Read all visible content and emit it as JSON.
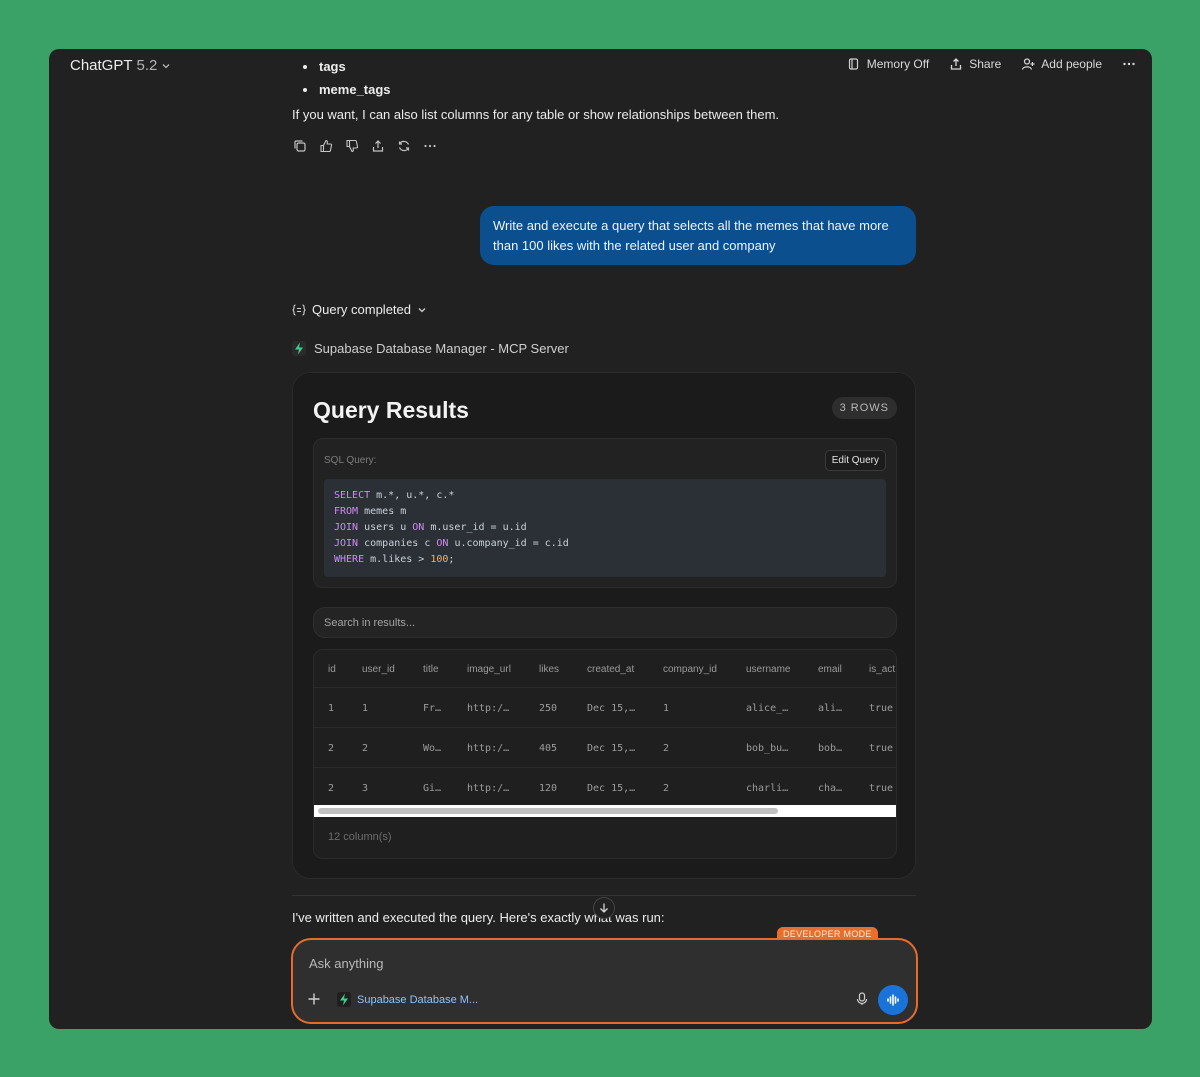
{
  "header": {
    "model_name": "ChatGPT",
    "model_version": "5.2",
    "memory_label": "Memory Off",
    "share_label": "Share",
    "add_people_label": "Add people"
  },
  "assistant_prev": {
    "bullets": [
      "tags",
      "meme_tags"
    ],
    "paragraph": "If you want, I can also list columns for any table or show relationships between them."
  },
  "user_message": "Write and execute a query that selects all the memes that have more than 100 likes with the related user and company",
  "query_status": "Query completed",
  "mcp_server": "Supabase Database Manager - MCP Server",
  "results": {
    "title": "Query Results",
    "rows_badge": "3 ROWS",
    "sql_label": "SQL Query:",
    "edit_query_label": "Edit Query",
    "search_placeholder": "Search in results...",
    "columns": [
      "id",
      "user_id",
      "title",
      "image_url",
      "likes",
      "created_at",
      "company_id",
      "username",
      "email",
      "is_act"
    ],
    "rows": [
      [
        "1",
        "1",
        "Fr…",
        "http:/…",
        "250",
        "Dec 15,…",
        "1",
        "alice_…",
        "ali…",
        "true"
      ],
      [
        "2",
        "2",
        "Wo…",
        "http:/…",
        "405",
        "Dec 15,…",
        "2",
        "bob_bu…",
        "bob…",
        "true"
      ],
      [
        "2",
        "3",
        "Gi…",
        "http:/…",
        "120",
        "Dec 15,…",
        "2",
        "charli…",
        "cha…",
        "true"
      ]
    ],
    "column_count": "12 column(s)"
  },
  "final_text": "I've written and executed the query. Here's exactly what was run:",
  "composer": {
    "dev_badge": "DEVELOPER MODE",
    "placeholder": "Ask anything",
    "tool_label": "Supabase Database M..."
  },
  "colors": {
    "background": "#3aa267",
    "window": "#212121",
    "user_bubble": "#0c4f8e",
    "accent_orange": "#e66c2c",
    "voice_button": "#1a73d9"
  }
}
